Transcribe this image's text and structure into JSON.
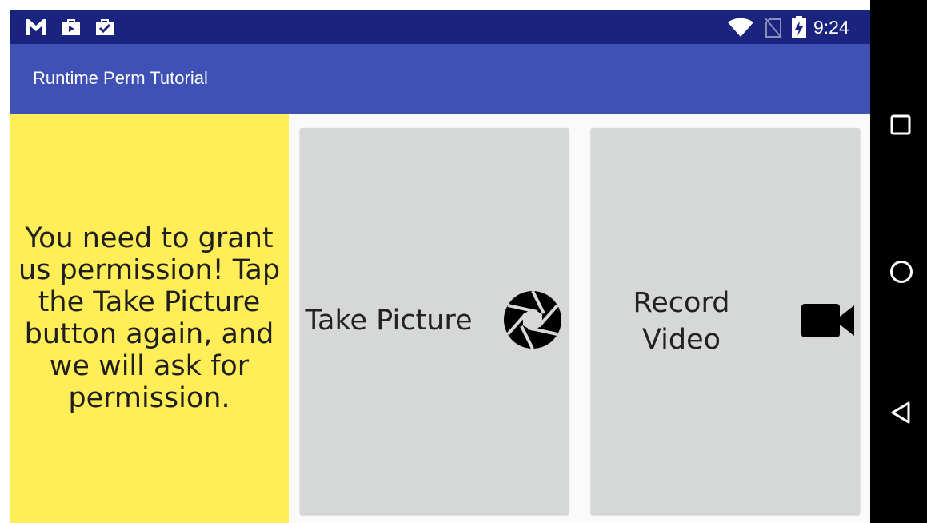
{
  "status_bar": {
    "time": "9:24",
    "left_icons": [
      "gmail-icon",
      "play-store-icon",
      "task-icon"
    ],
    "right_icons": [
      "wifi-icon",
      "no-sim-icon",
      "battery-charging-icon"
    ]
  },
  "app_bar": {
    "title": "Runtime Perm Tutorial"
  },
  "message": {
    "text": "You need to grant us permission! Tap the Take Picture button again, and we will ask for permission."
  },
  "buttons": {
    "take_picture": {
      "label": "Take Picture",
      "icon": "camera-shutter-icon"
    },
    "record_video": {
      "label": "Record Video",
      "icon": "videocam-icon"
    }
  },
  "nav_bar": {
    "icons": [
      "recents-square-icon",
      "home-circle-icon",
      "back-triangle-icon"
    ]
  },
  "colors": {
    "status_bar": "#1a237e",
    "app_bar": "#3f51b5",
    "message_background": "#ffee58",
    "card_background": "#d6d7d7",
    "nav_bar": "#000000"
  }
}
